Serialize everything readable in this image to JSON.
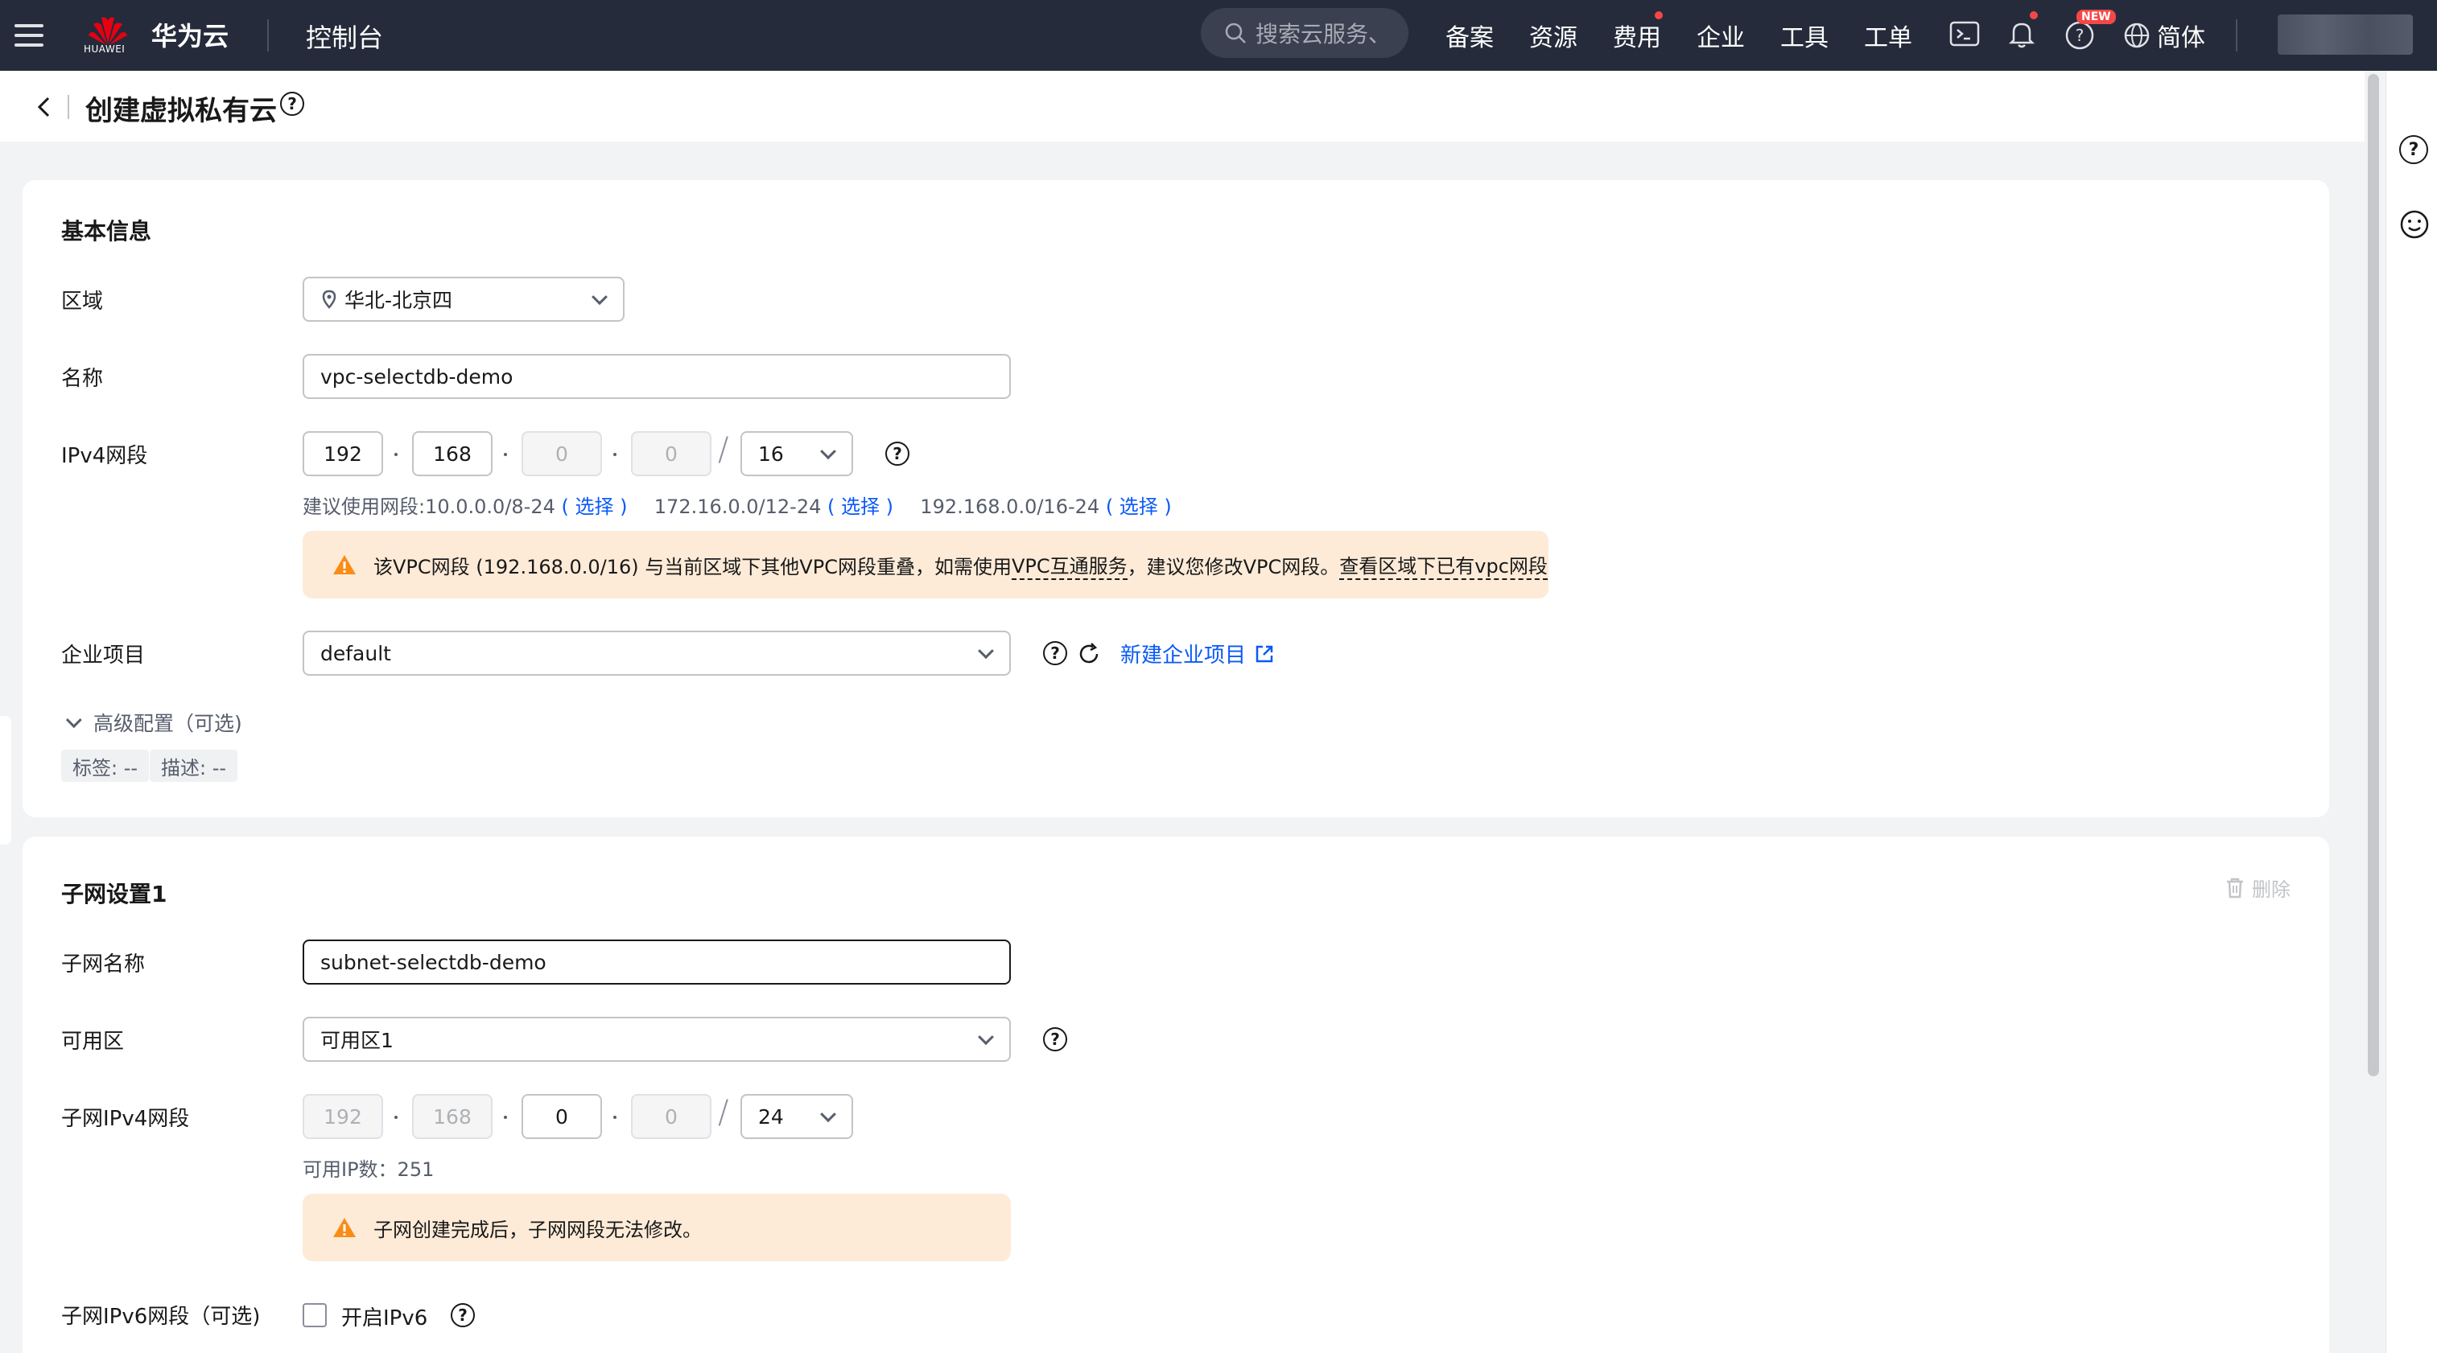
{
  "topbar": {
    "logo_text": "HUAWEI",
    "brand": "华为云",
    "console": "控制台",
    "search_placeholder": "搜索云服务、",
    "nav": [
      "备案",
      "资源",
      "费用",
      "企业",
      "工具",
      "工单"
    ],
    "new_badge": "NEW",
    "language": "简体"
  },
  "header": {
    "title": "创建虚拟私有云"
  },
  "basic": {
    "section_title": "基本信息",
    "region_label": "区域",
    "region_value": "华北-北京四",
    "name_label": "名称",
    "name_value": "vpc-selectdb-demo",
    "ipv4_label": "IPv4网段",
    "ip_octets": [
      "192",
      "168",
      "0",
      "0"
    ],
    "mask": "16",
    "suggest_prefix": "建议使用网段:10.0.0.0/8-24",
    "choose": "( 选择 )",
    "suggest_2": "172.16.0.0/12-24",
    "suggest_3": "192.168.0.0/16-24",
    "warning_part1": "该VPC网段 (192.168.0.0/16) 与当前区域下其他VPC网段重叠，如需使用",
    "warning_link1": "VPC互通服务",
    "warning_part2": "，建议您修改VPC网段。",
    "warning_link2": "查看区域下已有vpc网段",
    "enterprise_label": "企业项目",
    "enterprise_value": "default",
    "new_enterprise": "新建企业项目",
    "advanced": "高级配置（可选)",
    "tag_label": "标签: --",
    "desc_label": "描述: --"
  },
  "subnet": {
    "section_title": "子网设置1",
    "delete": "删除",
    "name_label": "子网名称",
    "name_value": "subnet-selectdb-demo",
    "az_label": "可用区",
    "az_value": "可用区1",
    "ipv4_label": "子网IPv4网段",
    "ip_octets": [
      "192",
      "168",
      "0",
      "0"
    ],
    "mask": "24",
    "available_ip": "可用IP数：251",
    "warning": "子网创建完成后，子网网段无法修改。",
    "ipv6_label": "子网IPv6网段（可选)",
    "ipv6_checkbox": "开启IPv6"
  },
  "colors": {
    "topbar": "#252b3a",
    "link": "#0a59f7",
    "warning_bg": "#fdebd8",
    "warning_icon": "#fa8c16",
    "logo_red": "#e60012"
  }
}
